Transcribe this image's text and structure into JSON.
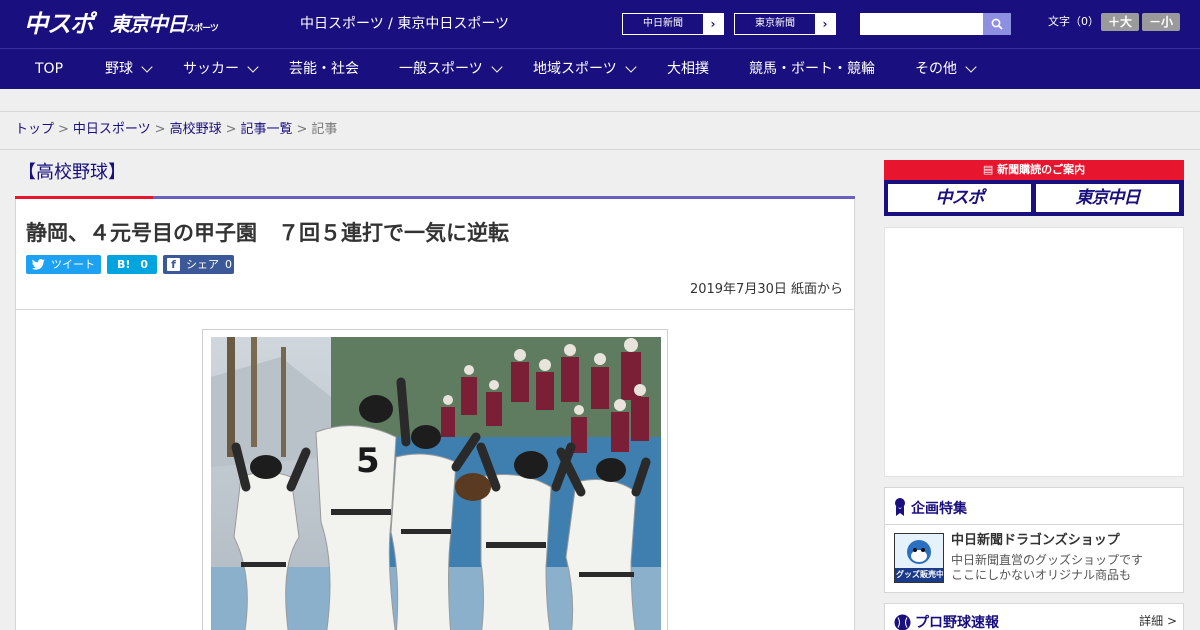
{
  "header": {
    "logo_chuspo": "中スポ",
    "logo_tokyo": "東京中日",
    "logo_tokyo_suffix": "スポーツ",
    "site_title": "中日スポーツ / 東京中日スポーツ",
    "paper_links": [
      {
        "label": "中日新聞",
        "arrow": "›"
      },
      {
        "label": "東京新聞",
        "arrow": "›"
      }
    ],
    "search_placeholder": "",
    "font_size_label": "文字（0）",
    "font_larger": "＋大",
    "font_smaller": "－小"
  },
  "nav": [
    {
      "label": "TOP",
      "dropdown": false
    },
    {
      "label": "野球",
      "dropdown": true
    },
    {
      "label": "サッカー",
      "dropdown": true
    },
    {
      "label": "芸能・社会",
      "dropdown": false
    },
    {
      "label": "一般スポーツ",
      "dropdown": true
    },
    {
      "label": "地域スポーツ",
      "dropdown": true
    },
    {
      "label": "大相撲",
      "dropdown": false
    },
    {
      "label": "競馬・ボート・競輪",
      "dropdown": false
    },
    {
      "label": "その他",
      "dropdown": true
    }
  ],
  "breadcrumb": {
    "items": [
      "トップ",
      "中日スポーツ",
      "高校野球",
      "記事一覧"
    ],
    "separator": ">",
    "current": "記事"
  },
  "article": {
    "category": "【高校野球】",
    "headline": "静岡、４元号目の甲子園　７回５連打で一気に逆転",
    "tweet_label": "ツイート",
    "hatena_label": "B!",
    "hatena_count": "0",
    "share_label": "シェア",
    "share_count": "0",
    "date": "2019年7月30日 紙面から",
    "photo_jersey_number": "5"
  },
  "sidebar": {
    "subscribe_title": "新聞購読のご案内",
    "subscribe_logos": [
      "中スポ",
      "東京中日"
    ],
    "feature_title": "企画特集",
    "shop_name": "中日新聞ドラゴンズショップ",
    "shop_desc_1": "中日新聞直営のグッズショップです",
    "shop_desc_2": "ここにしかないオリジナル商品も",
    "shop_badge": "グッズ販売中",
    "score_title": "プロ野球速報",
    "score_more": "詳細 >"
  },
  "colors": {
    "brand_navy": "#1a0f7e",
    "accent_red": "#e8152e",
    "accent_purple": "#6b5fc0",
    "twitter": "#1da1f2",
    "hatena": "#00a4de",
    "facebook": "#3b5998"
  }
}
